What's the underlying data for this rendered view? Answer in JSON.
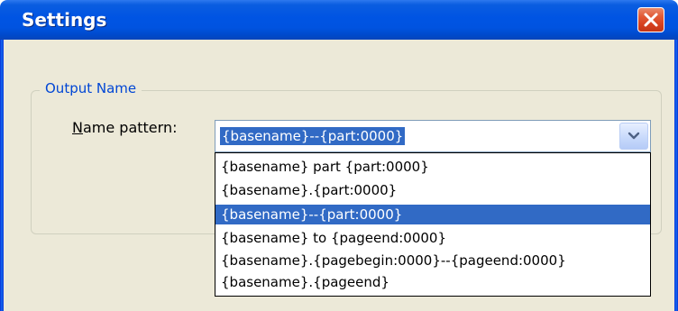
{
  "window": {
    "title": "Settings",
    "close_icon": "close-icon"
  },
  "group": {
    "legend": "Output Name"
  },
  "field": {
    "label_accel": "N",
    "label_rest": "ame pattern:"
  },
  "combo": {
    "value": "{basename}--{part:0000}",
    "button_icon": "chevron-down-icon"
  },
  "dropdown": {
    "items": [
      "{basename} part {part:0000}",
      "{basename}.{part:0000}",
      "{basename}--{part:0000}",
      "{basename} to {pageend:0000}",
      "{basename}.{pagebegin:0000}--{pageend:0000}",
      "{basename}.{pageend}"
    ],
    "selected_index": 2
  },
  "colors": {
    "titlebar": "#0054e3",
    "client": "#ece9d8",
    "selection": "#316ac5",
    "legend_text": "#0046d5",
    "close_button": "#e25b36"
  }
}
